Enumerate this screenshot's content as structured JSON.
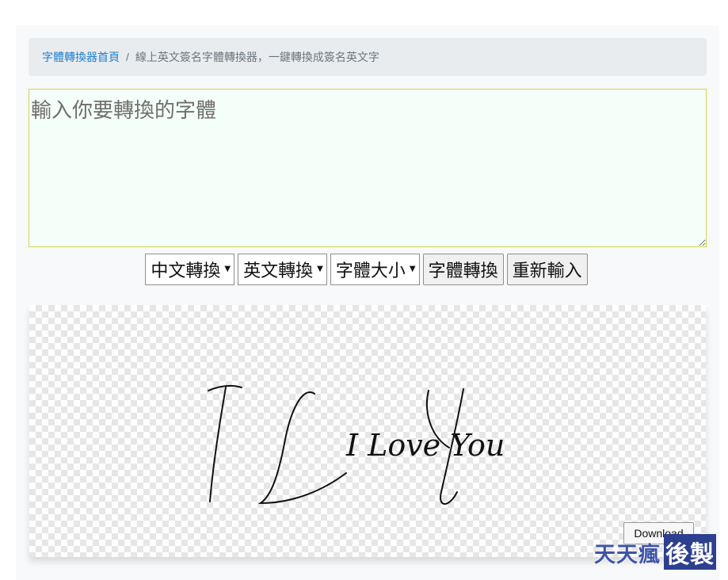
{
  "breadcrumb": {
    "home_label": "字體轉換器首頁",
    "separator": "/",
    "current_label": "線上英文簽名字體轉換器，一鍵轉換成簽名英文字"
  },
  "input": {
    "placeholder": "輸入你要轉換的字體",
    "value": ""
  },
  "controls": {
    "chinese_convert": "中文轉換",
    "english_convert": "英文轉換",
    "font_size": "字體大小",
    "convert_button": "字體轉換",
    "reset_button": "重新輸入"
  },
  "preview": {
    "signature_text": "I Love You",
    "download_label": "Download"
  },
  "watermark": {
    "left_text": "天天瘋",
    "right_text": "後製"
  },
  "colors": {
    "link": "#1f7fd1",
    "input_border": "#d6d34a",
    "input_bg": "#f5fff9",
    "watermark_blue": "#2d3f8f"
  }
}
